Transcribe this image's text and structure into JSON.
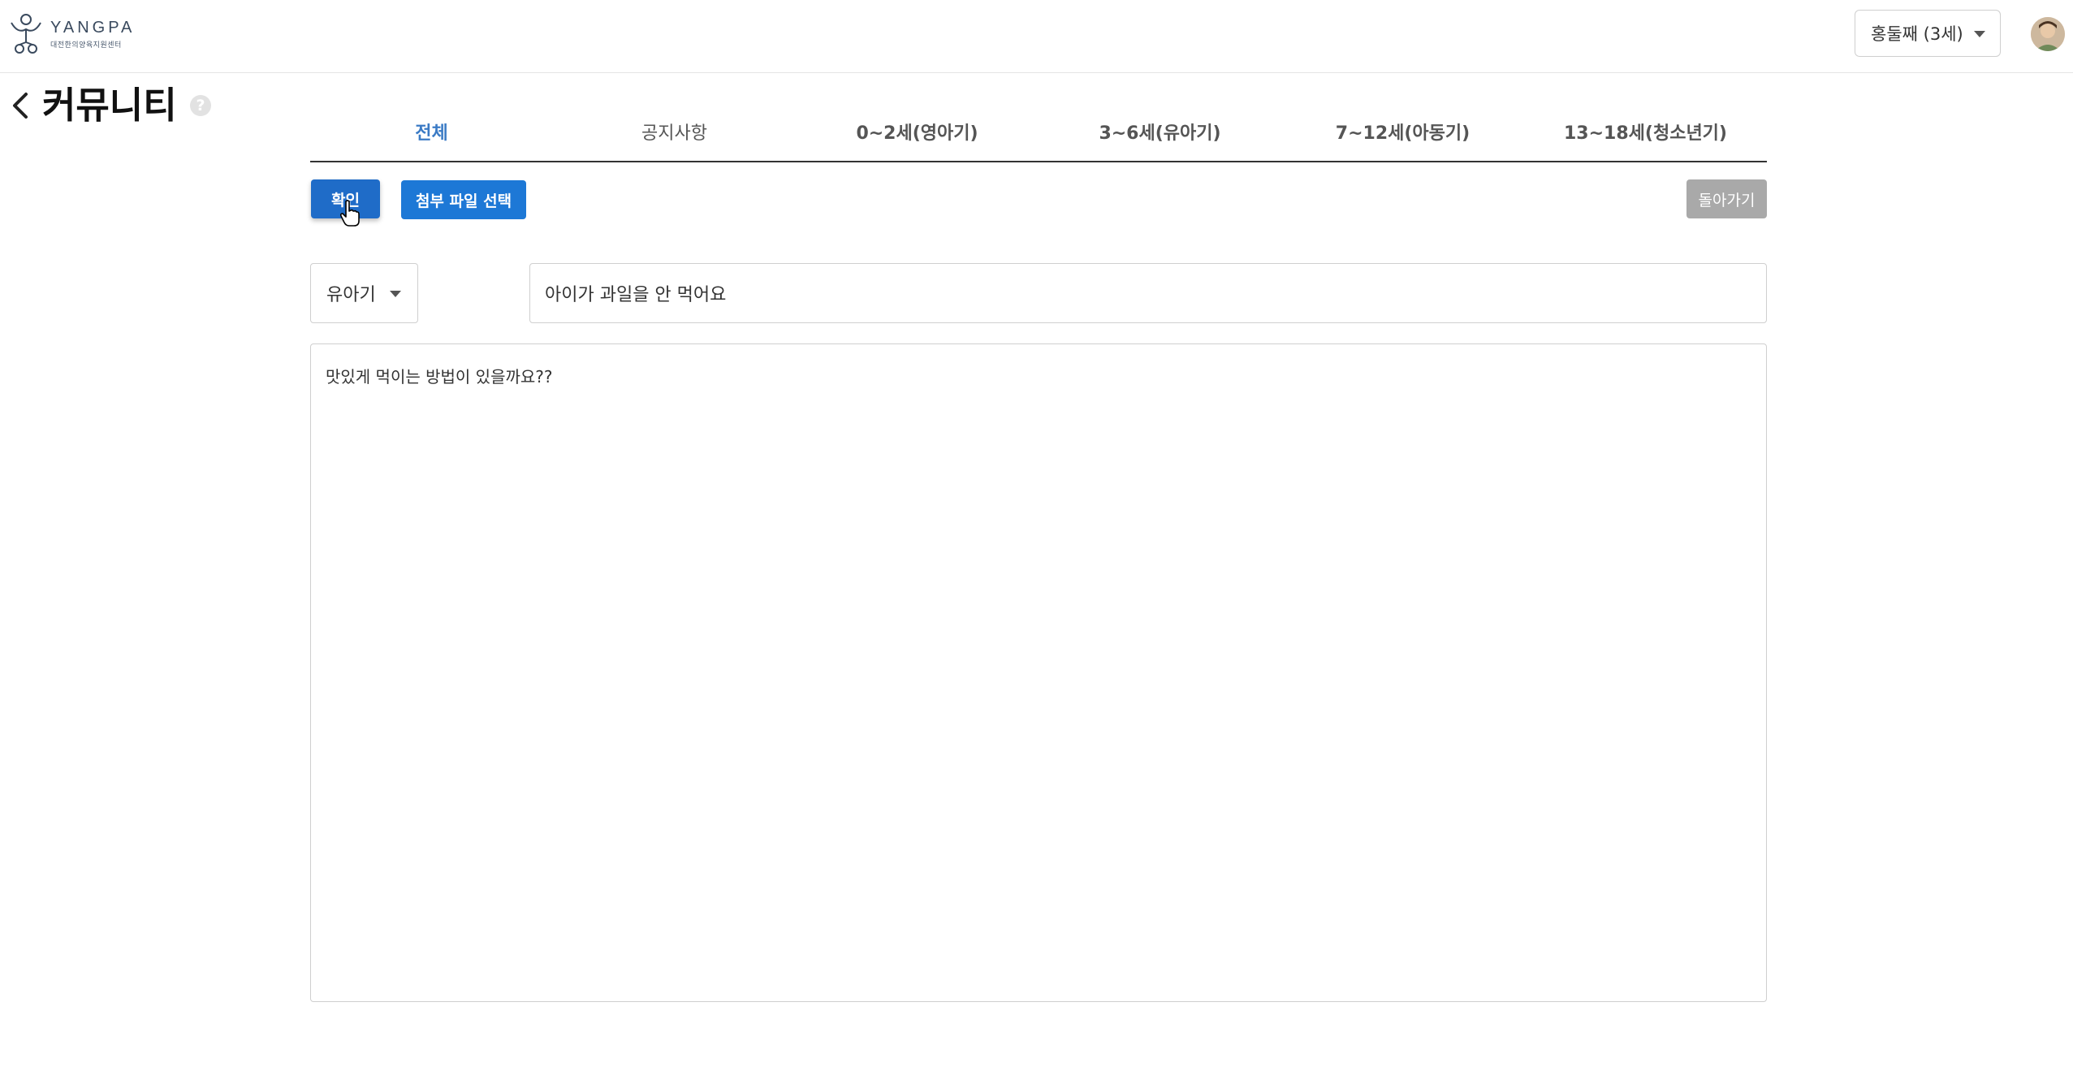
{
  "header": {
    "logo_name": "YANGPA",
    "logo_sub": "대전한의양육지원센터",
    "child_selector": "홍둘째 (3세)"
  },
  "page": {
    "title": "커뮤니티",
    "help": "?"
  },
  "tabs": [
    {
      "label": "전체",
      "active": true
    },
    {
      "label": "공지사항",
      "active": false
    },
    {
      "label": "0~2세(영아기)",
      "active": false
    },
    {
      "label": "3~6세(유아기)",
      "active": false
    },
    {
      "label": "7~12세(아동기)",
      "active": false
    },
    {
      "label": "13~18세(청소년기)",
      "active": false
    }
  ],
  "actions": {
    "confirm": "확인",
    "attach": "첨부 파일 선택",
    "back": "돌아가기"
  },
  "form": {
    "category": "유아기",
    "title_value": "아이가 과일을 안 먹어요",
    "body_value": "맛있게 먹이는 방법이 있을까요??"
  },
  "colors": {
    "accent": "#3b7bc5",
    "primary_button": "#1f6cc8",
    "disabled_button": "#a9a9a9"
  }
}
